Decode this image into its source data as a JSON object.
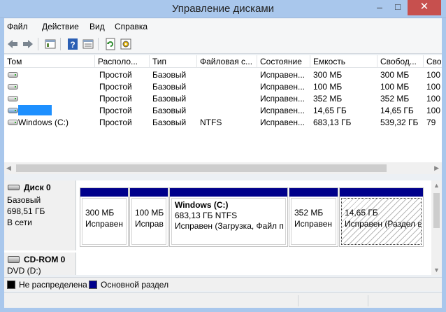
{
  "window": {
    "title": "Управление дисками",
    "minimize": "–",
    "maximize": "□",
    "close": "✕"
  },
  "menu": [
    "Файл",
    "Действие",
    "Вид",
    "Справка"
  ],
  "toolbar_icons": [
    "back-icon",
    "forward-icon",
    "properties-icon",
    "help-icon",
    "show-hide-icon",
    "refresh-icon",
    "settings-icon"
  ],
  "columns": [
    "Том",
    "Располо...",
    "Тип",
    "Файловая с...",
    "Состояние",
    "Емкость",
    "Свобод...",
    "Сво"
  ],
  "volumes": [
    {
      "name": "",
      "layout": "Простой",
      "type": "Базовый",
      "fs": "",
      "status": "Исправен...",
      "capacity": "300 МБ",
      "free": "300 МБ",
      "pct": "100"
    },
    {
      "name": "",
      "layout": "Простой",
      "type": "Базовый",
      "fs": "",
      "status": "Исправен...",
      "capacity": "100 МБ",
      "free": "100 МБ",
      "pct": "100"
    },
    {
      "name": "",
      "layout": "Простой",
      "type": "Базовый",
      "fs": "",
      "status": "Исправен...",
      "capacity": "352 МБ",
      "free": "352 МБ",
      "pct": "100"
    },
    {
      "name": "",
      "layout": "Простой",
      "type": "Базовый",
      "fs": "",
      "status": "Исправен...",
      "capacity": "14,65 ГБ",
      "free": "14,65 ГБ",
      "pct": "100"
    },
    {
      "name": "Windows (C:)",
      "layout": "Простой",
      "type": "Базовый",
      "fs": "NTFS",
      "status": "Исправен...",
      "capacity": "683,13 ГБ",
      "free": "539,32 ГБ",
      "pct": "79"
    }
  ],
  "disk0": {
    "name": "Диск 0",
    "type": "Базовый",
    "size": "698,51 ГБ",
    "state": "В сети",
    "partitions": [
      {
        "line1": "",
        "line2": "300 МБ",
        "line3": "Исправен"
      },
      {
        "line1": "",
        "line2": "100 МБ",
        "line3": "Исправ"
      },
      {
        "line1": "Windows  (C:)",
        "line2": "683,13 ГБ NTFS",
        "line3": "Исправен (Загрузка, Файл п"
      },
      {
        "line1": "",
        "line2": "352 МБ",
        "line3": "Исправен"
      },
      {
        "line1": "",
        "line2": "14,65 ГБ",
        "line3": "Исправен (Раздел в"
      }
    ]
  },
  "cdrom": {
    "name": "CD-ROM 0",
    "type": "DVD (D:)"
  },
  "legend": {
    "unallocated": "Не распределена",
    "primary": "Основной раздел",
    "primary_color": "#00008b",
    "unallocated_color": "#000000"
  }
}
